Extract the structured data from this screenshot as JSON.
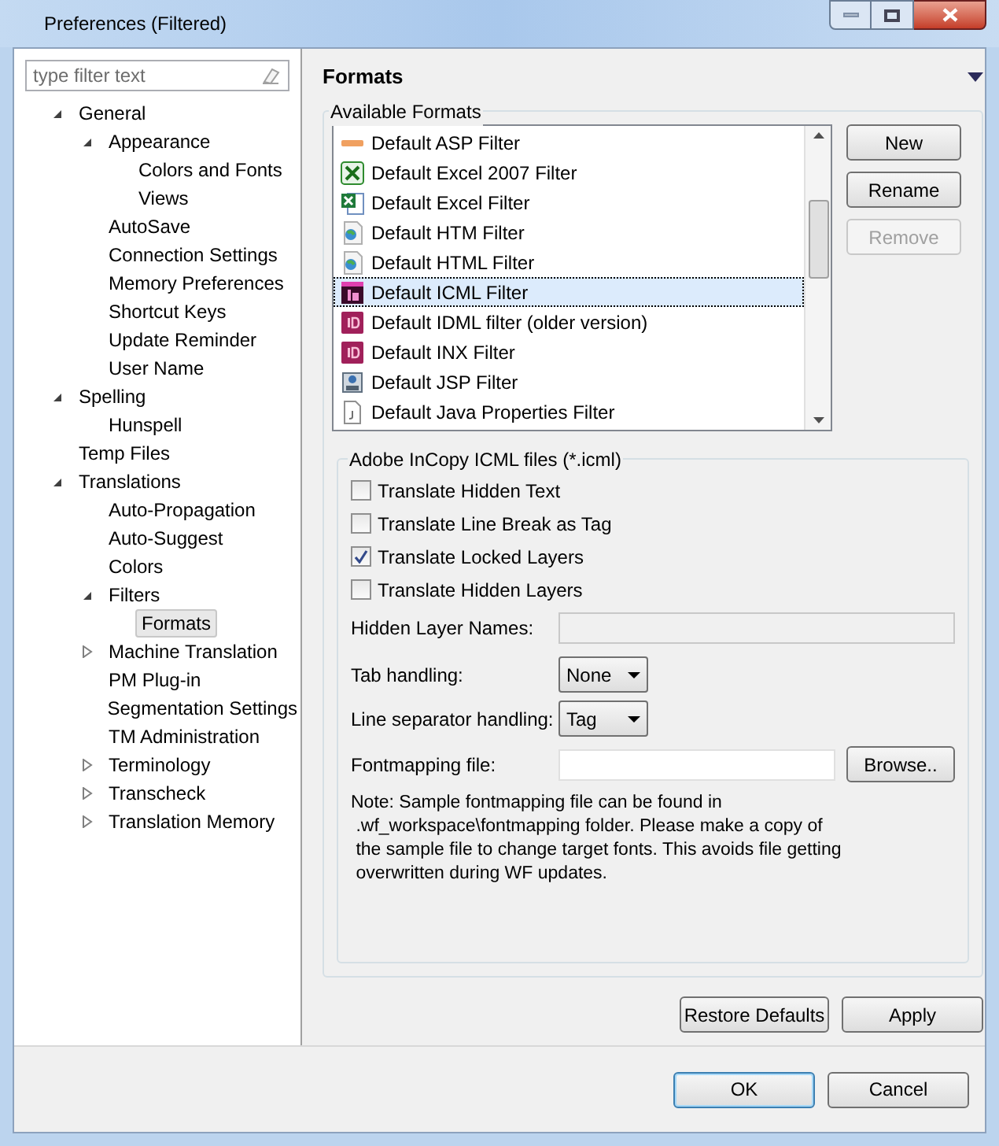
{
  "window": {
    "title": "Preferences (Filtered)"
  },
  "filter": {
    "placeholder": "type filter text"
  },
  "tree": [
    {
      "label": "General",
      "expanded": true,
      "selected": false,
      "children": [
        {
          "label": "Appearance",
          "expanded": true,
          "selected": false,
          "children": [
            {
              "label": "Colors and Fonts",
              "selected": false
            },
            {
              "label": "Views",
              "selected": false
            }
          ]
        },
        {
          "label": "AutoSave",
          "selected": false
        },
        {
          "label": "Connection Settings",
          "selected": false
        },
        {
          "label": "Memory Preferences",
          "selected": false
        },
        {
          "label": "Shortcut Keys",
          "selected": false
        },
        {
          "label": "Update Reminder",
          "selected": false
        },
        {
          "label": "User Name",
          "selected": false
        }
      ]
    },
    {
      "label": "Spelling",
      "expanded": true,
      "selected": false,
      "children": [
        {
          "label": "Hunspell",
          "selected": false
        }
      ]
    },
    {
      "label": "Temp Files",
      "selected": false
    },
    {
      "label": "Translations",
      "expanded": true,
      "selected": false,
      "children": [
        {
          "label": "Auto-Propagation",
          "selected": false
        },
        {
          "label": "Auto-Suggest",
          "selected": false
        },
        {
          "label": "Colors",
          "selected": false
        },
        {
          "label": "Filters",
          "expanded": true,
          "selected": false,
          "children": [
            {
              "label": "Formats",
              "selected": true
            }
          ]
        },
        {
          "label": "Machine Translation",
          "expanded": false,
          "selected": false
        },
        {
          "label": "PM Plug-in",
          "selected": false
        },
        {
          "label": "Segmentation Settings",
          "selected": false
        },
        {
          "label": "TM Administration",
          "selected": false
        },
        {
          "label": "Terminology",
          "expanded": false,
          "selected": false
        },
        {
          "label": "Transcheck",
          "expanded": false,
          "selected": false
        },
        {
          "label": "Translation Memory",
          "expanded": false,
          "selected": false
        }
      ]
    }
  ],
  "page": {
    "title": "Formats",
    "formats_group": "Available Formats",
    "formats": [
      {
        "label": "Default ASP Filter",
        "kind": "asp",
        "selected": false
      },
      {
        "label": "Default Excel 2007 Filter",
        "kind": "excel2007",
        "selected": false
      },
      {
        "label": "Default Excel Filter",
        "kind": "excel",
        "selected": false
      },
      {
        "label": "Default HTM Filter",
        "kind": "web",
        "selected": false
      },
      {
        "label": "Default HTML Filter",
        "kind": "web",
        "selected": false
      },
      {
        "label": "Default ICML Filter",
        "kind": "incopy",
        "selected": true
      },
      {
        "label": "Default IDML filter (older version)",
        "kind": "indesign",
        "selected": false
      },
      {
        "label": "Default INX Filter",
        "kind": "indesign",
        "selected": false
      },
      {
        "label": "Default JSP Filter",
        "kind": "jsp",
        "selected": false
      },
      {
        "label": "Default Java Properties Filter",
        "kind": "java",
        "selected": false
      }
    ],
    "format_buttons": [
      {
        "label": "New",
        "disabled": false
      },
      {
        "label": "Rename",
        "disabled": false
      },
      {
        "label": "Remove",
        "disabled": true
      }
    ],
    "options_group": "Adobe InCopy ICML files (*.icml)",
    "checkboxes": [
      {
        "label": "Translate Hidden Text",
        "checked": false
      },
      {
        "label": "Translate Line Break as Tag",
        "checked": false
      },
      {
        "label": "Translate Locked Layers",
        "checked": true
      },
      {
        "label": "Translate Hidden Layers",
        "checked": false
      }
    ],
    "hidden_layer_names": {
      "label": "Hidden Layer Names:",
      "disabled": true
    },
    "tab_handling": {
      "label": "Tab handling:",
      "value": "None"
    },
    "line_separator": {
      "label": "Line separator handling:",
      "value": "Tag"
    },
    "fontmapping": {
      "label": "Fontmapping file:",
      "button": "Browse.."
    },
    "note": "Note: Sample fontmapping file can be found in\n .wf_workspace\\fontmapping folder. Please make a copy of\n the sample file to change target fonts. This avoids file getting\n overwritten during WF updates.",
    "buttons": [
      "Restore Defaults",
      "Apply"
    ]
  },
  "dialog_buttons": [
    "OK",
    "Cancel"
  ]
}
